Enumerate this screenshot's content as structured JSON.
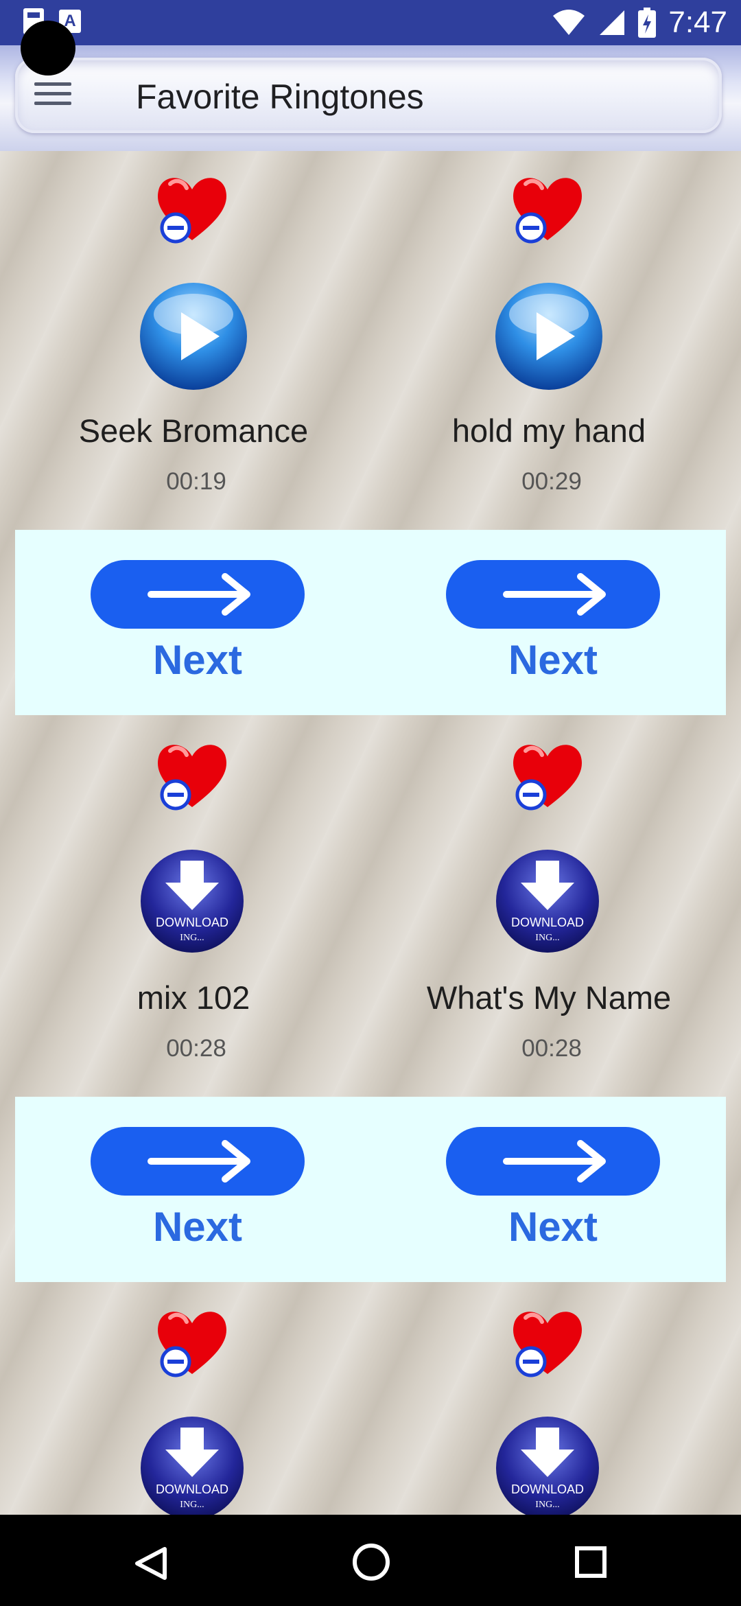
{
  "status_bar": {
    "time": "7:47",
    "icons": [
      "sd-card-icon",
      "text-a-icon",
      "wifi-icon",
      "signal-icon",
      "battery-charging-icon"
    ]
  },
  "app_bar": {
    "title": "Favorite Ringtones",
    "menu_icon": "hamburger-menu-icon"
  },
  "ringtones": [
    {
      "title": "Seek Bromance",
      "duration": "00:19",
      "action": "play"
    },
    {
      "title": "hold my hand",
      "duration": "00:29",
      "action": "play"
    },
    {
      "title": "mix 102",
      "duration": "00:28",
      "action": "download"
    },
    {
      "title": "What's My Name",
      "duration": "00:28",
      "action": "download"
    },
    {
      "title": "",
      "duration": "",
      "action": "download"
    },
    {
      "title": "",
      "duration": "",
      "action": "download"
    }
  ],
  "next_label": "Next",
  "download_badge": {
    "line1": "DOWNLOAD",
    "line2": "ING..."
  },
  "colors": {
    "status_bar": "#2f3f9d",
    "ad_band": "#e6ffff",
    "next_blue": "#1a5ff0",
    "heart_red": "#e8000a"
  },
  "nav_bar": {
    "buttons": [
      "back-triangle-icon",
      "home-circle-icon",
      "recents-square-icon"
    ]
  }
}
